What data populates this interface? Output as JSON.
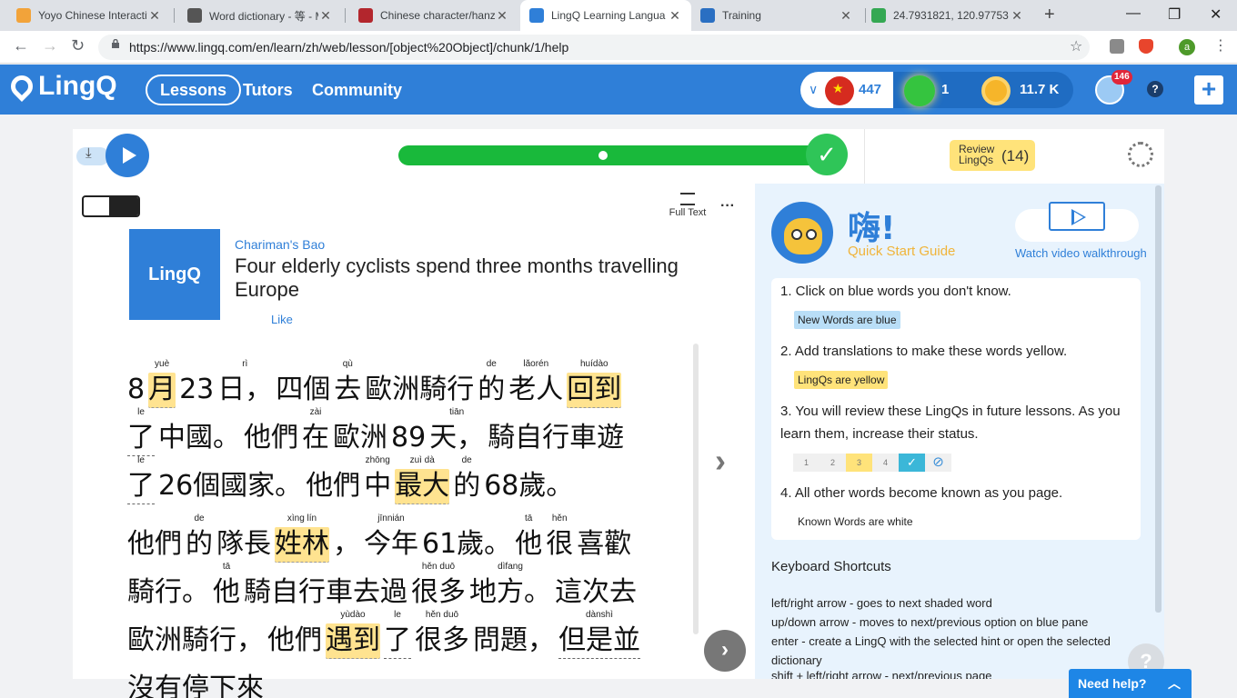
{
  "browser": {
    "tabs": [
      {
        "title": "Yoyo Chinese Interactiv",
        "favicon_color": "#f2a33a"
      },
      {
        "title": "Word dictionary - 等 - M",
        "favicon_color": "#555555"
      },
      {
        "title": "Chinese character/hanz",
        "favicon_color": "#b3262d"
      },
      {
        "title": "LingQ Learning Langua",
        "favicon_color": "#2f7fd8"
      },
      {
        "title": "Training",
        "favicon_color": "#2a6fc2"
      },
      {
        "title": "24.7931821, 120.97753",
        "favicon_color": "#34a853"
      }
    ],
    "url": "https://www.lingq.com/en/learn/zh/web/lesson/[object%20Object]/chunk/1/help",
    "profile_initial": "a"
  },
  "header": {
    "logo_text": "LingQ",
    "nav": [
      "Lessons",
      "Tutors",
      "Community"
    ],
    "known_words": "447",
    "lingqs_count": "1",
    "coins": "11.7 K",
    "notif_count": "146",
    "help_glyph": "?",
    "add_glyph": "+"
  },
  "player": {
    "progress_fraction": 1.0,
    "review_label_1": "Review",
    "review_label_2": "LingQs",
    "review_count": "(14)"
  },
  "reader": {
    "full_text_label": "Full Text",
    "more_glyph": "···",
    "thumb_text": "LingQ",
    "source": "Chariman's Bao",
    "title": "Four elderly cyclists spend three months travelling Europe",
    "like": "Like",
    "lines": [
      [
        {
          "t": "8",
          "p": ""
        },
        {
          "t": "月",
          "p": "yuè",
          "s": "yel"
        },
        {
          "t": "23",
          "p": ""
        },
        {
          "t": "日，",
          "p": "rì"
        },
        {
          "t": "四個",
          "p": ""
        },
        {
          "t": "去",
          "p": "qù"
        },
        {
          "t": "歐洲騎行",
          "p": ""
        },
        {
          "t": "的",
          "p": "de"
        },
        {
          "t": "老人",
          "p": "lǎorén"
        },
        {
          "t": "回到",
          "p": "huídào",
          "s": "yel"
        }
      ],
      [
        {
          "t": "了",
          "p": "le",
          "s": "blu"
        },
        {
          "t": "中國。",
          "p": ""
        },
        {
          "t": "他們",
          "p": ""
        },
        {
          "t": "在",
          "p": "zài"
        },
        {
          "t": "歐洲",
          "p": ""
        },
        {
          "t": "89",
          "p": ""
        },
        {
          "t": "天，",
          "p": "tiān"
        },
        {
          "t": "騎自行車遊",
          "p": ""
        }
      ],
      [
        {
          "t": "了",
          "p": "le",
          "s": "blu"
        },
        {
          "t": "26個國家。",
          "p": ""
        },
        {
          "t": "他們",
          "p": ""
        },
        {
          "t": "中",
          "p": "zhōng"
        },
        {
          "t": "最大",
          "p": "zuì dà",
          "s": "yel"
        },
        {
          "t": "的",
          "p": "de"
        },
        {
          "t": "68歲。",
          "p": ""
        }
      ],
      [
        {
          "t": "他們",
          "p": ""
        },
        {
          "t": "的",
          "p": "de"
        },
        {
          "t": "隊長",
          "p": ""
        },
        {
          "t": "姓林",
          "p": "xìng lín",
          "s": "yel"
        },
        {
          "t": "，",
          "p": ""
        },
        {
          "t": "今年",
          "p": "jīnnián"
        },
        {
          "t": "61歲。",
          "p": ""
        },
        {
          "t": "他",
          "p": "tā"
        },
        {
          "t": "很",
          "p": "hěn"
        },
        {
          "t": "喜歡",
          "p": ""
        }
      ],
      [
        {
          "t": "騎行。",
          "p": ""
        },
        {
          "t": "他",
          "p": "tā"
        },
        {
          "t": "騎自行車去過",
          "p": ""
        },
        {
          "t": "很多",
          "p": "hěn duō"
        },
        {
          "t": "地方。",
          "p": "dìfang"
        },
        {
          "t": "這次去",
          "p": ""
        }
      ],
      [
        {
          "t": "歐洲騎行，",
          "p": ""
        },
        {
          "t": "他們",
          "p": ""
        },
        {
          "t": "遇到",
          "p": "yùdào",
          "s": "yel"
        },
        {
          "t": "了",
          "p": "le",
          "s": "blu"
        },
        {
          "t": "很多",
          "p": "hěn duō"
        },
        {
          "t": "問題，",
          "p": ""
        },
        {
          "t": "但是並",
          "p": "dànshì",
          "s": "blu"
        }
      ],
      [
        {
          "t": "沒有停下來",
          "p": ""
        }
      ]
    ]
  },
  "help": {
    "greeting": "嗨!",
    "quick_start": "Quick Start Guide",
    "watch_video": "Watch video walkthrough",
    "step1": "1. Click on blue words you don't know.",
    "chip1": "New Words are blue",
    "step2": "2. Add translations to make these words yellow.",
    "chip2": "LingQs are yellow",
    "step3": "3. You will review these LingQs in future lessons. As you learn them, increase their status.",
    "status_levels": [
      "1",
      "2",
      "3",
      "4",
      "✓",
      "⊘"
    ],
    "step4": "4. All other words become known as you page.",
    "chip4": "Known Words are white",
    "shortcuts_title": "Keyboard Shortcuts",
    "shortcuts": [
      {
        "key": "left/right arrow",
        "desc": " - goes to next shaded word"
      },
      {
        "key": "up/down arrow",
        "desc": " - moves to next/previous option on blue pane"
      },
      {
        "key": "enter",
        "desc": " - create a LingQ with the selected hint or open the selected dictionary"
      },
      {
        "key": "shift + left/right arrow",
        "desc": " - next/previous page"
      }
    ],
    "need_help": "Need help?",
    "float_glyph": "?"
  }
}
